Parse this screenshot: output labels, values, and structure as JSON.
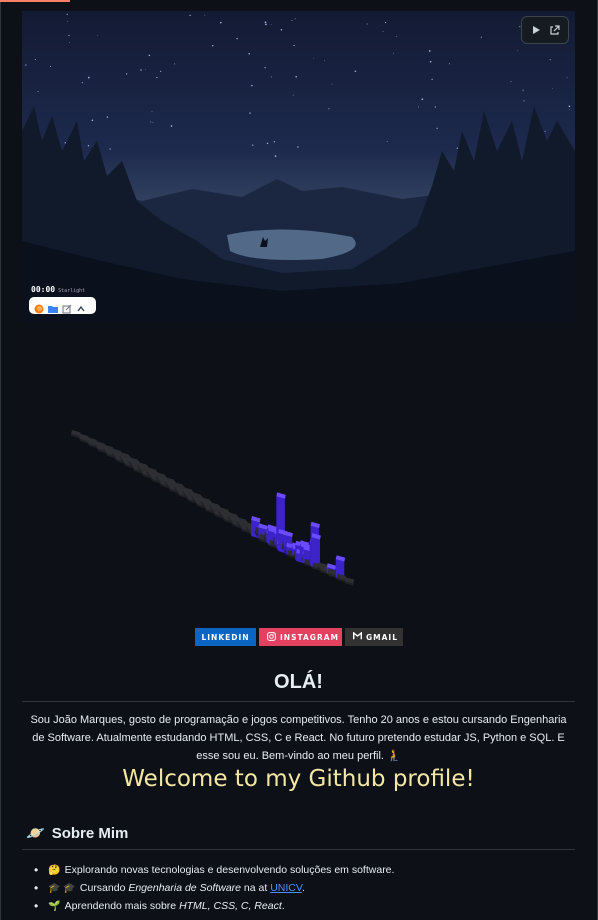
{
  "video": {
    "clock_time": "00:00",
    "clock_label": "Starlight",
    "controls": {
      "play_icon": "play-icon",
      "open_icon": "external-link-icon"
    },
    "dock_icons": [
      "firefox-icon",
      "folder-icon",
      "edit-icon",
      "chevron-up-icon"
    ]
  },
  "badges": [
    {
      "label": "LINKEDIN",
      "color": "#0a66c2"
    },
    {
      "label": "INSTAGRAM",
      "color": "#e4405f"
    },
    {
      "label": "GMAIL",
      "color": "#323232"
    }
  ],
  "greeting": "OLÁ!",
  "bio": "Sou João Marques, gosto de programação e jogos competitivos. Tenho 20 anos e estou cursando Engenharia de Software. Atualmente estudando HTML, CSS, C e React. No futuro pretendo estudar JS, Python e SQL. E esse sou eu. Bem-vindo ao meu perfil. 🧎",
  "welcome": "Welcome to my Github profile!",
  "about": {
    "emoji": "🪐",
    "title": "Sobre Mim"
  },
  "items": [
    {
      "emoji": "🤔",
      "text": "Explorando novas tecnologias e desenvolvendo soluções em software."
    },
    {
      "emoji": "🎓 🎓",
      "prefix": "Cursando ",
      "course": "Engenharia de Software",
      "middle": " na at ",
      "link": "UNICV",
      "suffix": "."
    },
    {
      "emoji": "🌱",
      "prefix": "Aprendendo mais sobre ",
      "topics": "HTML, CSS, C, React",
      "suffix": "."
    }
  ],
  "colors": {
    "background": "#0d1117",
    "accent_purple": "#5b3df5",
    "welcome_text": "#f4e6a3",
    "link": "#4493f8"
  }
}
